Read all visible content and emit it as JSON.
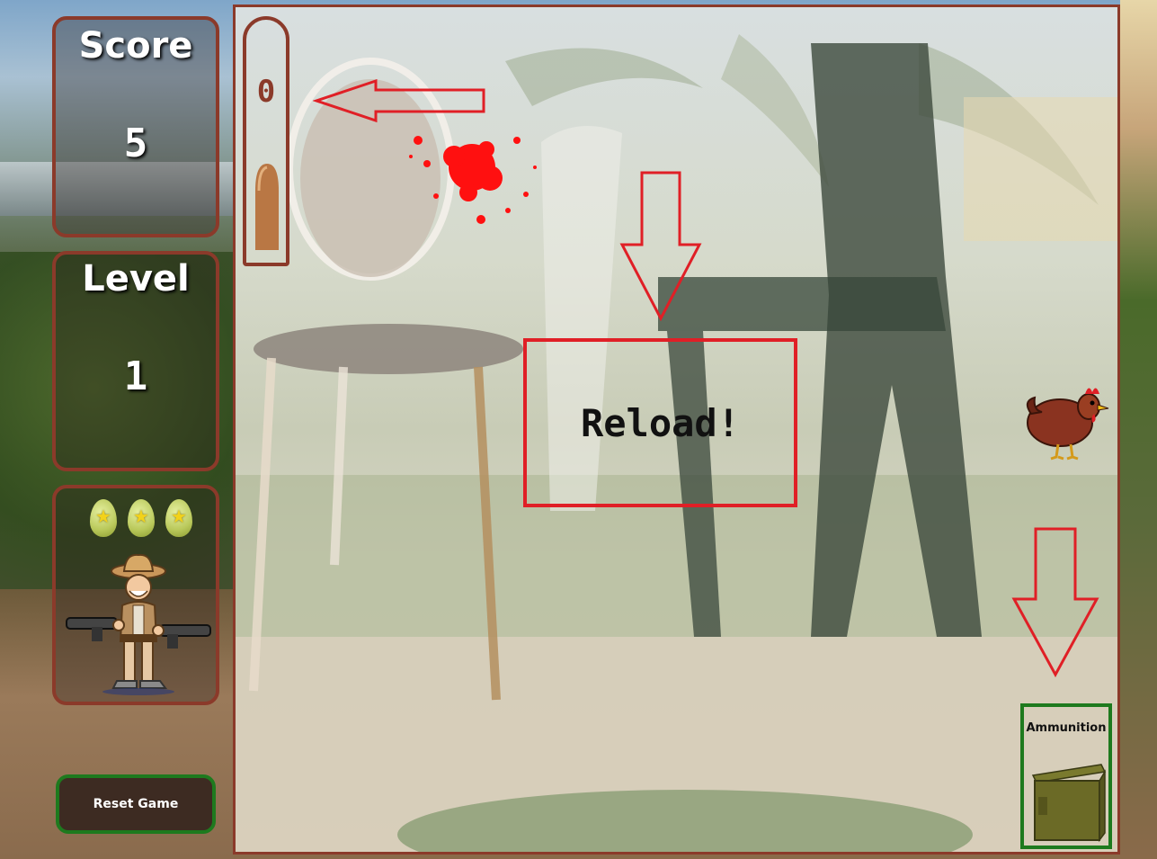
{
  "sidebar": {
    "score": {
      "title": "Score",
      "value": "5"
    },
    "level": {
      "title": "Level",
      "value": "1"
    },
    "lives_eggs": 3,
    "reset_label": "Reset Game"
  },
  "game": {
    "ammo_count": "0",
    "reload_message": "Reload!",
    "ammunition_label": "Ammunition"
  },
  "colors": {
    "panel_border": "#8b3a2a",
    "reset_border": "#1e7a1e",
    "alert_red": "#e01f26"
  }
}
